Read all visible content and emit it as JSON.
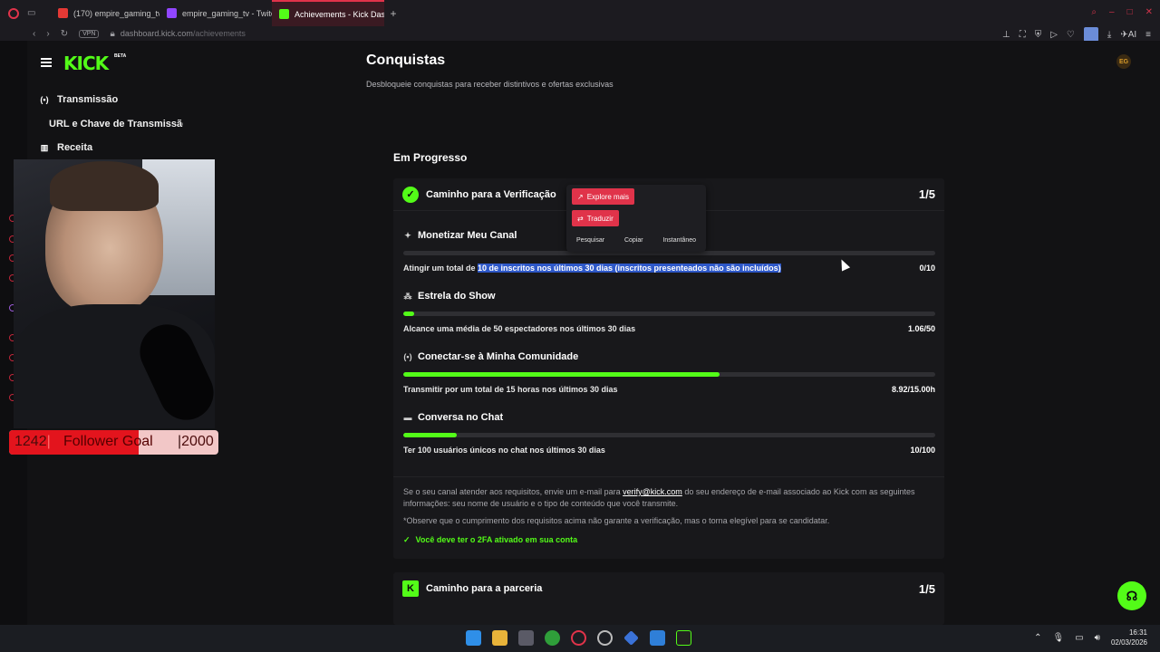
{
  "browser": {
    "tabs": [
      {
        "label": "(170) empire_gaming_tv -",
        "favicon_color": "#e53935"
      },
      {
        "label": "empire_gaming_tv - Twitc",
        "favicon_color": "#9146ff"
      },
      {
        "label": "Achievements - Kick Dash",
        "favicon_color": "#53fc18"
      }
    ],
    "vpn_label": "VPN",
    "url_host": "dashboard.kick.com",
    "url_path": "/achievements",
    "ai_label": "AI"
  },
  "kick": {
    "logo": "KICK",
    "beta": "BETA",
    "avatar_initials": "EG",
    "nav": [
      {
        "label": "Transmissão",
        "icon": "broadcast-icon"
      },
      {
        "label": "URL e Chave de Transmissão"
      },
      {
        "label": "Receita",
        "icon": "chart-icon"
      }
    ]
  },
  "stream_overlay": {
    "follower_goal": {
      "current_label": "1242",
      "label": "Follower Goal",
      "target_label": "2000",
      "current": 1242,
      "target": 2000
    }
  },
  "main": {
    "title": "Conquistas",
    "subtitle": "Desbloqueie conquistas para receber distintivos e ofertas exclusivas",
    "section": "Em Progresso",
    "verification_card": {
      "title": "Caminho para a Verificação",
      "count": "1/5",
      "tasks": [
        {
          "title": "Monetizar Meu Canal",
          "desc_prefix": "Atingir um total de ",
          "desc_highlight": "10 de inscritos nos últimos 30 dias (inscritos presenteados não são incluídos)",
          "value": "0/10",
          "progress": 0.0
        },
        {
          "title": "Estrela do Show",
          "desc": "Alcance uma média de 50 espectadores nos últimos 30 dias",
          "value": "1.06/50",
          "progress": 0.021
        },
        {
          "title": "Conectar-se à Minha Comunidade",
          "desc": "Transmitir por um total de 15 horas nos últimos 30 dias",
          "value": "8.92/15.00h",
          "progress": 0.595
        },
        {
          "title": "Conversa no Chat",
          "desc": "Ter 100 usuários únicos no chat nos últimos 30 dias",
          "value": "10/100",
          "progress": 0.1
        }
      ],
      "footer_text_1": "Se o seu canal atender aos requisitos, envie um e-mail para",
      "footer_email": "verify@kick.com",
      "footer_text_2": "do seu endereço de e-mail associado ao Kick com as seguintes informações: seu nome de usuário e o tipo de conteúdo que você transmite.",
      "footer_note": "*Observe que o cumprimento dos requisitos acima não garante a verificação, mas o torna elegível para se candidatar.",
      "requirement": "Você deve ter o 2FA ativado em sua conta"
    },
    "partner_card": {
      "title": "Caminho para a parceria",
      "count": "1/5"
    }
  },
  "context_popup": {
    "explore": "Explore mais",
    "translate": "Traduzir",
    "links": [
      "Pesquisar",
      "Copiar",
      "Instantâneo"
    ]
  },
  "taskbar": {
    "time": "16:31",
    "date": "02/03/2026"
  },
  "colors": {
    "accent": "#53fc18",
    "opera_red": "#e0334a",
    "highlight": "#2e58c8"
  }
}
